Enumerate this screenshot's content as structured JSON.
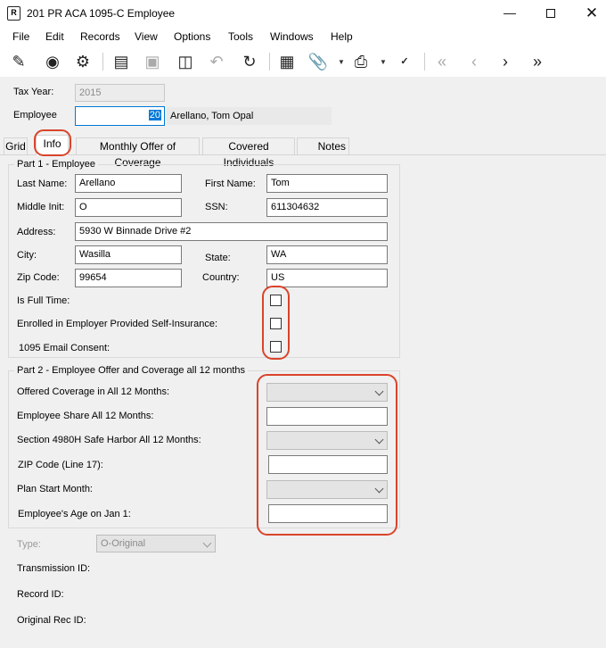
{
  "window": {
    "title": "201 PR ACA 1095-C Employee",
    "app_icon_glyph": "R"
  },
  "menu": [
    "File",
    "Edit",
    "Records",
    "View",
    "Options",
    "Tools",
    "Windows",
    "Help"
  ],
  "toolbar_icons": [
    "edit-icon",
    "binoculars-icon",
    "settings-gear-icon",
    "document-icon",
    "save-icon",
    "delete-trash-icon",
    "undo-icon",
    "refresh-icon",
    "calculator-icon",
    "attachment-icon",
    "print-icon",
    "spell-check-icon",
    "first-record-icon",
    "previous-record-icon",
    "next-record-icon",
    "last-record-icon"
  ],
  "header": {
    "tax_year_label": "Tax Year:",
    "tax_year": "2015",
    "employee_label": "Employee",
    "employee_number": "20",
    "employee_name": "Arellano, Tom Opal"
  },
  "tabs": [
    "Grid",
    "Info",
    "Monthly Offer of Coverage",
    "Covered Individuals",
    "Notes"
  ],
  "active_tab": "Info",
  "part1": {
    "title": "Part 1 - Employee",
    "last_name_label": "Last Name:",
    "last_name": "Arellano",
    "first_name_label": "First Name:",
    "first_name": "Tom",
    "middle_init_label": "Middle Init:",
    "middle_init": "O",
    "ssn_label": "SSN:",
    "ssn": "611304632",
    "address_label": "Address:",
    "address": "5930 W Binnade Drive #2",
    "city_label": "City:",
    "city": "Wasilla",
    "state_label": "State:",
    "state": "WA",
    "zip_label": "Zip Code:",
    "zip": "99654",
    "country_label": "Country:",
    "country": "US",
    "full_time_label": "Is Full Time:",
    "self_insurance_label": "Enrolled in Employer Provided Self-Insurance:",
    "email_consent_label": "1095 Email Consent:"
  },
  "part2": {
    "title": "Part 2 - Employee Offer and Coverage all 12 months",
    "offered_coverage_label": "Offered Coverage in All 12 Months:",
    "employee_share_label": "Employee Share All 12 Months:",
    "safe_harbor_label": "Section 4980H Safe Harbor All 12 Months:",
    "zip_line17_label": "ZIP Code (Line 17):",
    "plan_start_label": "Plan Start Month:",
    "age_label": "Employee's Age on Jan 1:"
  },
  "footer": {
    "type_label": "Type:",
    "type_value": "O-Original",
    "transmission_id_label": "Transmission ID:",
    "record_id_label": "Record ID:",
    "original_rec_id_label": "Original Rec ID:"
  },
  "colors": {
    "highlight": "#d9442b",
    "selection": "#0078d7",
    "field_border": "#7a7a7a"
  }
}
